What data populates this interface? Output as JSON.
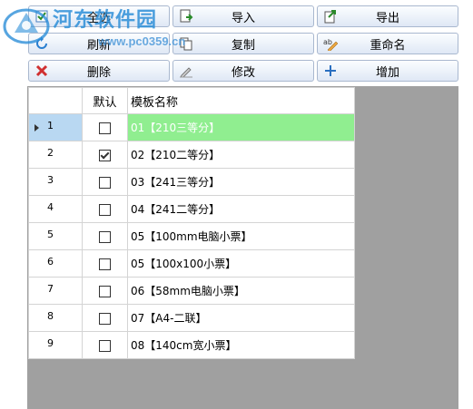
{
  "watermark": {
    "title": "河东软件园",
    "url": "www.pc0359.cn"
  },
  "toolbar": {
    "row1": [
      {
        "label": "全选",
        "icon": "select-all-icon"
      },
      {
        "label": "导入",
        "icon": "import-icon"
      },
      {
        "label": "导出",
        "icon": "export-icon"
      }
    ],
    "row2": [
      {
        "label": "刷新",
        "icon": "refresh-icon"
      },
      {
        "label": "复制",
        "icon": "copy-icon"
      },
      {
        "label": "重命名",
        "icon": "rename-icon"
      }
    ],
    "row3": [
      {
        "label": "删除",
        "icon": "delete-icon"
      },
      {
        "label": "修改",
        "icon": "edit-icon"
      },
      {
        "label": "增加",
        "icon": "add-icon"
      }
    ]
  },
  "grid": {
    "columns": [
      "默认",
      "模板名称"
    ],
    "rows": [
      {
        "num": "1",
        "default": false,
        "name": "01【210三等分】",
        "selected": true
      },
      {
        "num": "2",
        "default": true,
        "name": "02【210二等分】",
        "selected": false
      },
      {
        "num": "3",
        "default": false,
        "name": "03【241三等分】",
        "selected": false
      },
      {
        "num": "4",
        "default": false,
        "name": "04【241二等分】",
        "selected": false
      },
      {
        "num": "5",
        "default": false,
        "name": "05【100mm电脑小票】",
        "selected": false
      },
      {
        "num": "6",
        "default": false,
        "name": "05【100x100小票】",
        "selected": false
      },
      {
        "num": "7",
        "default": false,
        "name": "06【58mm电脑小票】",
        "selected": false
      },
      {
        "num": "8",
        "default": false,
        "name": "07【A4-二联】",
        "selected": false
      },
      {
        "num": "9",
        "default": false,
        "name": "08【140cm宽小票】",
        "selected": false
      }
    ]
  },
  "colors": {
    "selected_name_bg": "#90ee90",
    "selected_rowhdr_bg": "#b9d8f2",
    "grid_bg": "#a0a0a0"
  }
}
